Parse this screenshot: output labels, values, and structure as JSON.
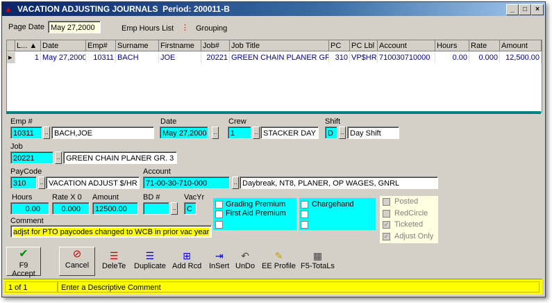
{
  "window": {
    "title": "VACATION ADJUSTING JOURNALS",
    "period_label": "Period:",
    "period": "200011-B",
    "buttons": {
      "minimize": "_",
      "maximize": "□",
      "close": "×"
    }
  },
  "header": {
    "page_date_label": "Page Date",
    "page_date": "May 27,2000",
    "emp_hours_list": "Emp Hours List",
    "grouping": "Grouping"
  },
  "grid": {
    "columns": [
      "L...",
      "Date",
      "Emp#",
      "Surname",
      "Firstname",
      "Job#",
      "Job Title",
      "PC",
      "PC Lbl",
      "Account",
      "Hours",
      "Rate",
      "Amount"
    ],
    "rows": [
      [
        "1",
        "May 27,2000",
        "10311",
        "BACH",
        "JOE",
        "20221",
        "GREEN CHAIN PLANER GR",
        "310",
        "VP$HR",
        "710030710000",
        "0.00",
        "0.000",
        "12,500.00"
      ]
    ]
  },
  "form": {
    "emp_label": "Emp #",
    "emp": "10311",
    "emp_name": "BACH,JOE",
    "date_label": "Date",
    "date": "May 27,2000",
    "crew_label": "Crew",
    "crew": "1",
    "crew_name": "STACKER DAY",
    "shift_label": "Shift",
    "shift": "D",
    "shift_name": "Day Shift",
    "job_label": "Job",
    "job": "20221",
    "job_name": "GREEN CHAIN PLANER GR. 3",
    "paycode_label": "PayCode",
    "paycode": "310",
    "paycode_name": "VACATION ADJUST $/HR",
    "account_label": "Account",
    "account": "71-00-30-710-000",
    "account_name": "Daybreak, NT8, PLANER, OP WAGES, GNRL",
    "hours_label": "Hours",
    "hours": "0.00",
    "rate_label": "Rate X 0",
    "rate": "0.000",
    "amount_label": "Amount",
    "amount": "12500.00",
    "bd_label": "BD #",
    "bd": "",
    "vacyr_label": "VacYr",
    "vacyr": "C",
    "comment_label": "Comment",
    "comment": "adjst for PTO paycodes changed to WCB in prior vac year",
    "premiums": [
      "Grading Premium",
      "First Aid Premium",
      ""
    ],
    "chargehand": "Chargehand",
    "flags": [
      {
        "label": "Posted",
        "checked": false
      },
      {
        "label": "RedCircle",
        "checked": false
      },
      {
        "label": "Ticketed",
        "checked": true
      },
      {
        "label": "Adjust Only",
        "checked": true
      }
    ]
  },
  "toolbar": {
    "accept": "F9 Accept",
    "cancel": "Cancel",
    "delete": "DeleTe",
    "duplicate": "Duplicate",
    "add_record": "Add Rcd",
    "insert": "InSert",
    "undo": "UnDo",
    "ee_profile": "EE Profile",
    "totals": "F5-TotaLs"
  },
  "status": {
    "record": "1 of 1",
    "message": "Enter a Descriptive Comment"
  }
}
